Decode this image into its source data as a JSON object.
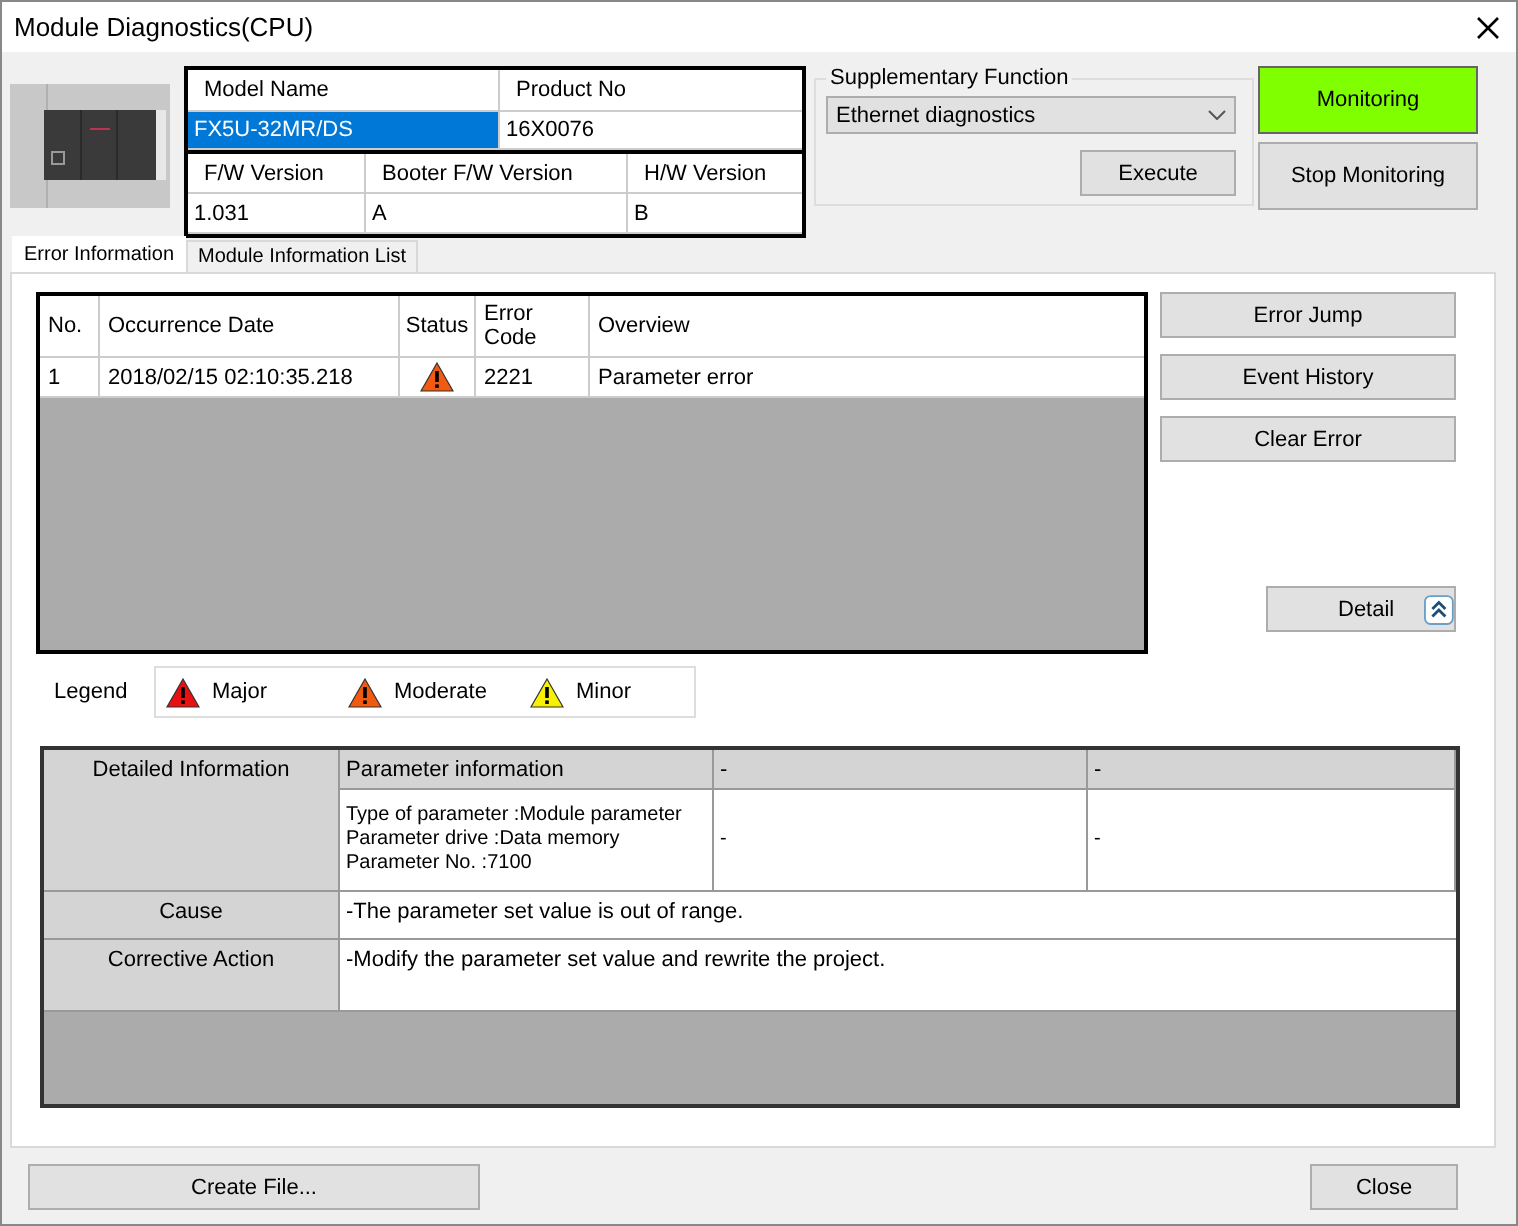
{
  "window": {
    "title": "Module Diagnostics(CPU)"
  },
  "model_table": {
    "header": [
      "Model Name",
      "Product No"
    ],
    "values": [
      {
        "text": "FX5U-32MR/DS",
        "selected": true
      },
      {
        "text": "16X0076",
        "selected": false
      }
    ]
  },
  "version_table": {
    "header": [
      "F/W Version",
      "Booter F/W Version",
      "H/W Version"
    ],
    "values": [
      "1.031",
      "A",
      "B"
    ]
  },
  "supplementary_function": {
    "label": "Supplementary Function",
    "dropdown": "Ethernet diagnostics",
    "button": "Execute"
  },
  "monitor_buttons": [
    {
      "label": "Monitoring",
      "selected": true
    },
    {
      "label": "Stop Monitoring",
      "selected": false
    }
  ],
  "tabs": [
    {
      "label": "Error Information",
      "selected": true
    },
    {
      "label": "Module Information List",
      "selected": false
    }
  ],
  "error_table": {
    "columns": [
      "No.",
      "Occurrence Date",
      "Status",
      "Error Code",
      "Overview"
    ],
    "rows": [
      {
        "no": "1",
        "date": "2018/02/15 02:10:35.218",
        "kind": "moderate",
        "code": "2221",
        "overview": "Parameter error"
      }
    ]
  },
  "side_buttons": [
    "Error Jump",
    "Event History",
    "Clear Error"
  ],
  "detail_button": "Detail",
  "legend": {
    "label": "Legend",
    "items": [
      {
        "kind": "major",
        "label": "Major"
      },
      {
        "kind": "moderate",
        "label": "Moderate"
      },
      {
        "kind": "minor",
        "label": "Minor"
      }
    ]
  },
  "detailed_information": {
    "label": "Detailed Information",
    "header": [
      "Parameter information",
      "-",
      "-"
    ],
    "values": [
      [
        "Type of parameter :Module parameter",
        "Parameter drive :Data memory",
        "Parameter No. :7100"
      ],
      [
        "-"
      ],
      [
        "-"
      ]
    ]
  },
  "cause": {
    "label": "Cause",
    "text": "-The parameter set value is out of range."
  },
  "corrective_action": {
    "label": "Corrective Action",
    "text": "-Modify the parameter set value and rewrite the project."
  },
  "footer_buttons": [
    "Create File...",
    "Close"
  ]
}
